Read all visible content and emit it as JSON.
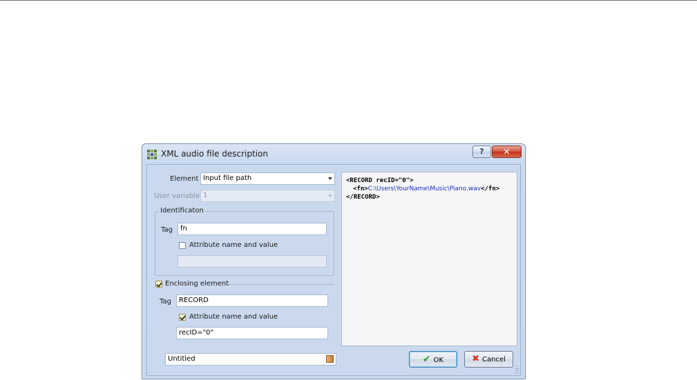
{
  "window": {
    "title": "XML audio file description",
    "help_label": "?",
    "close_label": "✕"
  },
  "form": {
    "element_label": "Element",
    "element_value": "Input file path",
    "user_variable_label": "User variable",
    "user_variable_value": "1",
    "identification": {
      "legend": "Identificaton",
      "tag_label": "Tag",
      "tag_value": "fn",
      "attr_label": "Attribute name and value",
      "attr_checked": false,
      "attr_value": ""
    },
    "enclosing": {
      "label": "Enclosing element",
      "checked": true,
      "tag_label": "Tag",
      "tag_value": "RECORD",
      "attr_label": "Attribute name and value",
      "attr_checked": true,
      "attr_value": "recID=\"0\""
    },
    "file_name": "Untitled"
  },
  "preview": {
    "line1_open": "<RECORD recID=",
    "line1_val": "\"0\"",
    "line1_close": ">",
    "line2_open": "<fn>",
    "line2_path": "C:\\Users\\YourName\\Music\\Piano.wav",
    "line2_close": "</fn>",
    "line3": "</RECORD>"
  },
  "buttons": {
    "ok": "OK",
    "cancel": "Cancel"
  },
  "colors": {
    "client_bg": "#cad9ee",
    "xml_value": "#1a2fb8",
    "ok_icon": "#2e9a2e",
    "cancel_icon": "#d13b2b"
  }
}
